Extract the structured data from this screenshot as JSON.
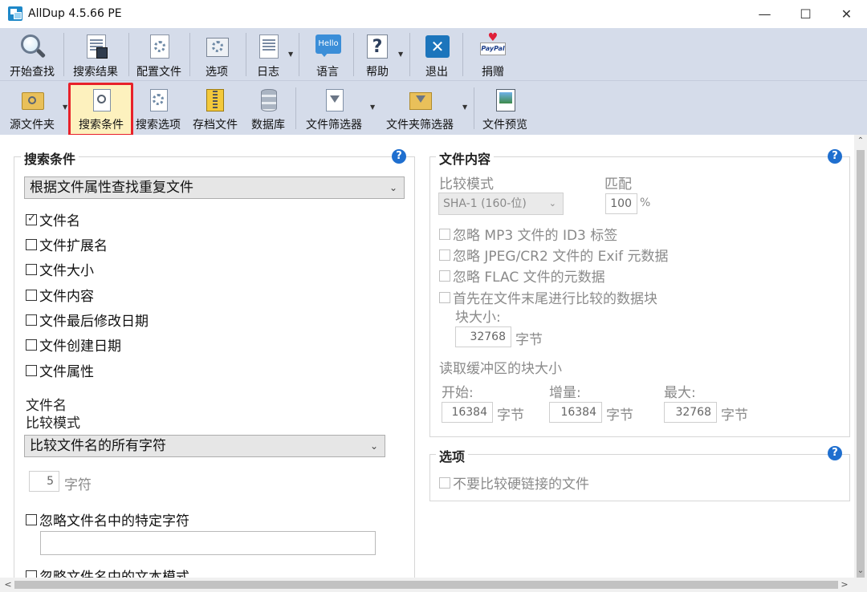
{
  "window": {
    "title": "AllDup 4.5.66 PE",
    "minimize": "—",
    "maximize": "☐",
    "close": "✕"
  },
  "toolbar1": {
    "start_search": "开始查找",
    "search_results": "搜索结果",
    "profile": "配置文件",
    "options": "选项",
    "log": "日志",
    "language": "语言",
    "language_icon_text": "Hello",
    "help": "帮助",
    "help_icon_text": "?",
    "exit": "退出",
    "exit_icon_text": "✕",
    "donate": "捐赠",
    "paypal_icon_text": "PayPal"
  },
  "toolbar2": {
    "source_folder": "源文件夹",
    "search_criteria": "搜索条件",
    "search_options": "搜索选项",
    "archive_files": "存档文件",
    "database": "数据库",
    "file_filter": "文件筛选器",
    "folder_filter": "文件夹筛选器",
    "file_preview": "文件预览"
  },
  "criteria": {
    "title": "搜索条件",
    "help": "?",
    "mode_select": "根据文件属性查找重复文件",
    "checkboxes": [
      {
        "label": "文件名",
        "checked": true
      },
      {
        "label": "文件扩展名",
        "checked": false
      },
      {
        "label": "文件大小",
        "checked": false
      },
      {
        "label": "文件内容",
        "checked": false
      },
      {
        "label": "文件最后修改日期",
        "checked": false
      },
      {
        "label": "文件创建日期",
        "checked": false
      },
      {
        "label": "文件属性",
        "checked": false
      }
    ],
    "filename_heading": "文件名",
    "compare_mode_label": "比较模式",
    "compare_mode_select": "比较文件名的所有字符",
    "chars_value": "5",
    "chars_unit": "字符",
    "ignore_chars_label": "忽略文件名中的特定字符",
    "ignore_chars_value": "",
    "ignore_pattern_label": "忽略文件名中的文本模式"
  },
  "content": {
    "title": "文件内容",
    "help": "?",
    "compare_mode_label": "比较模式",
    "compare_mode_value": "SHA-1 (160-位)",
    "match_label": "匹配",
    "match_value": "100",
    "match_unit": "%",
    "ignore_mp3": "忽略 MP3 文件的 ID3 标签",
    "ignore_jpeg": "忽略 JPEG/CR2 文件的 Exif 元数据",
    "ignore_flac": "忽略 FLAC 文件的元数据",
    "compare_end_first": "首先在文件末尾进行比较的数据块",
    "block_size_label": "块大小:",
    "block_size_value": "32768",
    "block_size_unit": "字节",
    "read_buffer_label": "读取缓冲区的块大小",
    "start_label": "开始:",
    "start_value": "16384",
    "start_unit": "字节",
    "increment_label": "增量:",
    "increment_value": "16384",
    "increment_unit": "字节",
    "max_label": "最大:",
    "max_value": "32768",
    "max_unit": "字节"
  },
  "options": {
    "title": "选项",
    "help": "?",
    "no_hardlinks": "不要比较硬链接的文件"
  },
  "scroll": {
    "up": "⌃",
    "down": "⌄",
    "left": "<",
    "right": ">"
  }
}
